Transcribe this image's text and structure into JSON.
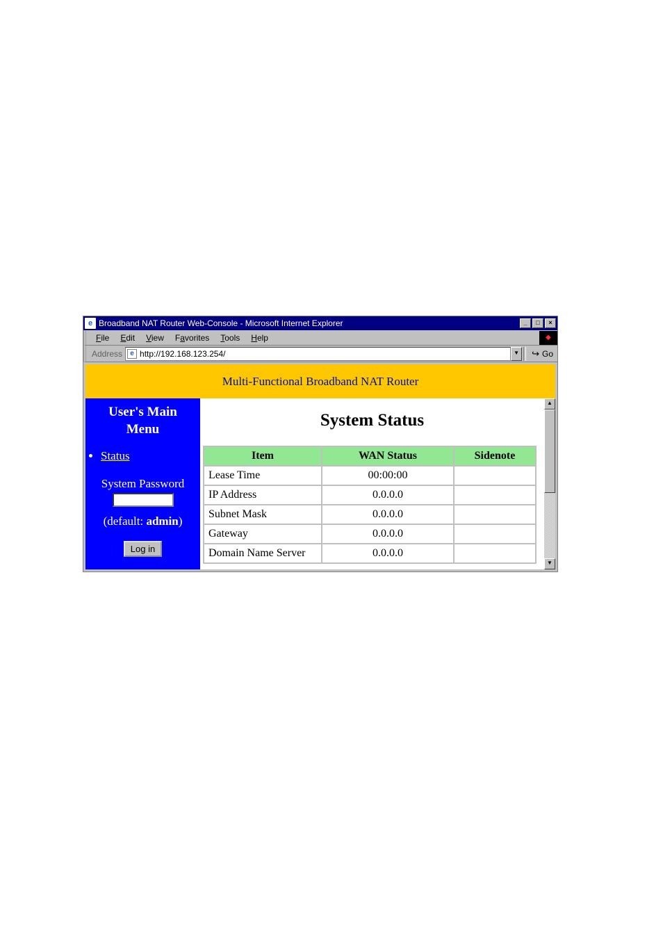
{
  "window": {
    "title": "Broadband NAT Router Web-Console - Microsoft Internet Explorer"
  },
  "menus": {
    "file": "File",
    "edit": "Edit",
    "view": "View",
    "favorites": "Favorites",
    "tools": "Tools",
    "help": "Help"
  },
  "addressbar": {
    "label": "Address",
    "url": "http://192.168.123.254/",
    "go": "Go"
  },
  "banner": {
    "text": "Multi-Functional Broadband NAT Router"
  },
  "sidebar": {
    "title_line1": "User's Main",
    "title_line2": "Menu",
    "status_link": "Status",
    "password_label": "System Password",
    "default_prefix": "(default: ",
    "default_value": "admin",
    "default_suffix": ")",
    "login_button": "Log in"
  },
  "content": {
    "heading": "System Status",
    "headers": {
      "item": "Item",
      "wan": "WAN Status",
      "sidenote": "Sidenote"
    },
    "rows": [
      {
        "item": "Lease Time",
        "wan": "00:00:00",
        "sidenote": ""
      },
      {
        "item": "IP Address",
        "wan": "0.0.0.0",
        "sidenote": ""
      },
      {
        "item": "Subnet Mask",
        "wan": "0.0.0.0",
        "sidenote": ""
      },
      {
        "item": "Gateway",
        "wan": "0.0.0.0",
        "sidenote": ""
      },
      {
        "item": "Domain Name Server",
        "wan": "0.0.0.0",
        "sidenote": ""
      }
    ]
  }
}
